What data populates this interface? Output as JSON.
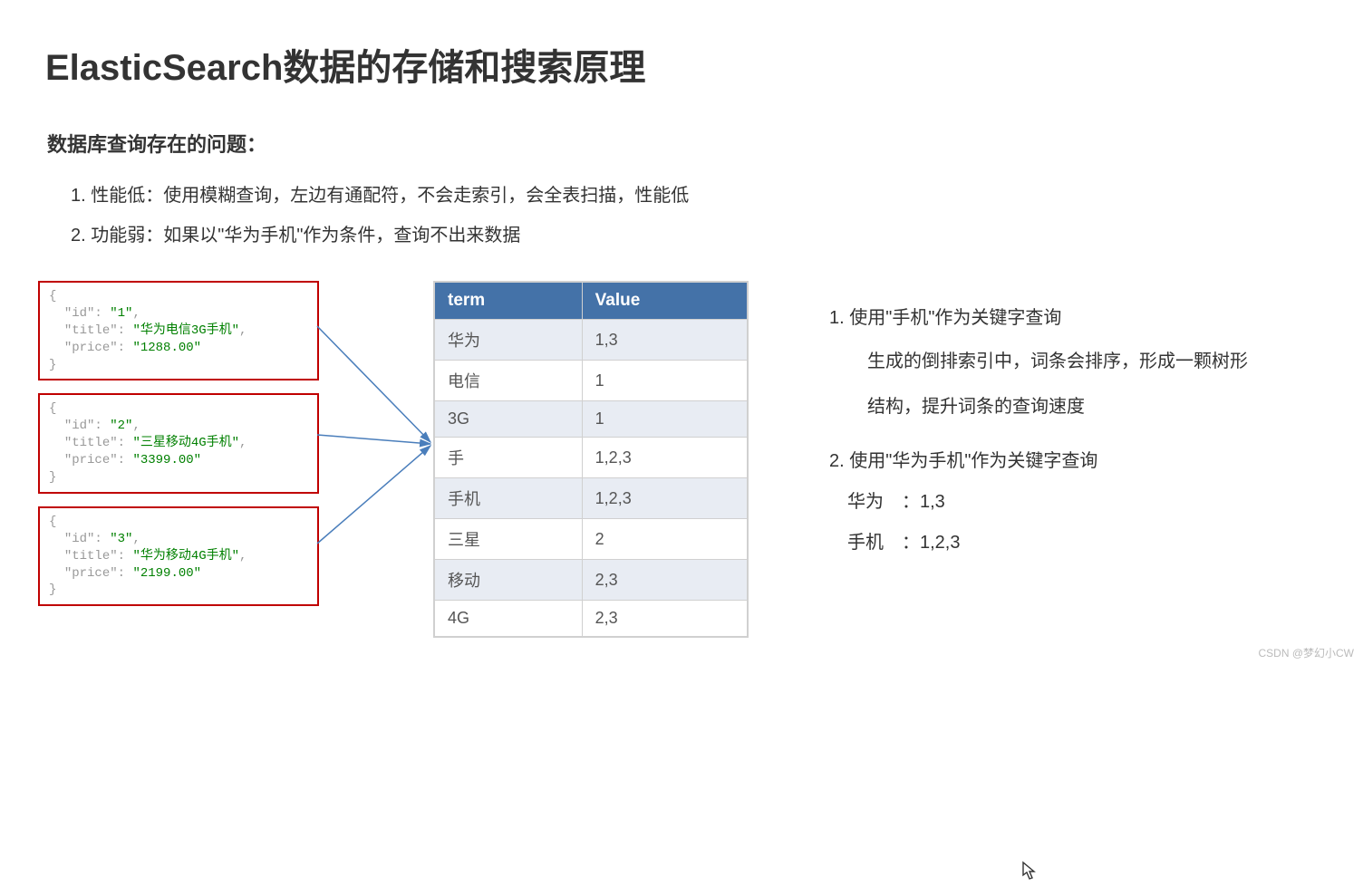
{
  "title": "ElasticSearch数据的存储和搜索原理",
  "subtitle": "数据库查询存在的问题：",
  "points": {
    "p1": "1. 性能低：使用模糊查询，左边有通配符，不会走索引，会全表扫描，性能低",
    "p2": "2. 功能弱：如果以\"华为手机\"作为条件，查询不出来数据"
  },
  "json": {
    "doc1": {
      "open": "{",
      "l1a": "\"id\": ",
      "l1b": "\"1\"",
      "l1c": ",",
      "l2a": "\"title\": ",
      "l2b": "\"华为电信3G手机\"",
      "l2c": ",",
      "l3a": "\"price\": ",
      "l3b": "\"1288.00\"",
      "close": "}"
    },
    "doc2": {
      "open": "{",
      "l1a": "\"id\": ",
      "l1b": "\"2\"",
      "l1c": ",",
      "l2a": "\"title\": ",
      "l2b": "\"三星移动4G手机\"",
      "l2c": ",",
      "l3a": "\"price\": ",
      "l3b": "\"3399.00\"",
      "close": "}"
    },
    "doc3": {
      "open": "{",
      "l1a": "\"id\": ",
      "l1b": "\"3\"",
      "l1c": ",",
      "l2a": "\"title\": ",
      "l2b": "\"华为移动4G手机\"",
      "l2c": ",",
      "l3a": "\"price\": ",
      "l3b": "\"2199.00\"",
      "close": "}"
    }
  },
  "table": {
    "h1": "term",
    "h2": "Value",
    "rows": [
      {
        "t": "华为",
        "v": "1,3"
      },
      {
        "t": "电信",
        "v": "1"
      },
      {
        "t": "3G",
        "v": "1"
      },
      {
        "t": "手",
        "v": "1,2,3"
      },
      {
        "t": "手机",
        "v": "1,2,3"
      },
      {
        "t": "三星",
        "v": "2"
      },
      {
        "t": "移动",
        "v": "2,3"
      },
      {
        "t": "4G",
        "v": "2,3"
      }
    ]
  },
  "right": {
    "item1": "1. 使用\"手机\"作为关键字查询",
    "sub1": "生成的倒排索引中，词条会排序，形成一颗树形",
    "sub2": "结构，提升词条的查询速度",
    "item2": "2. 使用\"华为手机\"作为关键字查询",
    "kv1": "华为　：1,3",
    "kv2": "手机　：1,2,3"
  },
  "watermark": "CSDN @梦幻小CW"
}
